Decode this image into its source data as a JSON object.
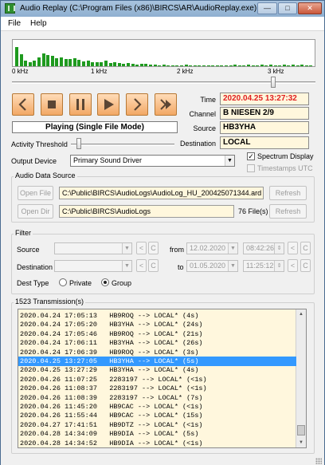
{
  "titlebar": {
    "title": "Audio Replay (C:\\Program Files (x86)\\BIRCS\\AR\\AudioReplay.exe)",
    "minimize": "—",
    "maximize": "□",
    "close": "✕"
  },
  "menu": {
    "file": "File",
    "help": "Help"
  },
  "spectrum": {
    "label_0": "0 kHz",
    "label_1": "1 kHz",
    "label_2": "2 kHz",
    "label_3": "3 kHz",
    "levels": [
      0.72,
      0.45,
      0.22,
      0.16,
      0.2,
      0.32,
      0.48,
      0.42,
      0.38,
      0.3,
      0.34,
      0.28,
      0.26,
      0.3,
      0.24,
      0.18,
      0.22,
      0.16,
      0.14,
      0.14,
      0.2,
      0.12,
      0.16,
      0.12,
      0.1,
      0.12,
      0.08,
      0.06,
      0.08,
      0.1,
      0.06,
      0.05,
      0.04,
      0.05,
      0.04,
      0.04,
      0.03,
      0.04,
      0.05,
      0.03,
      0.04,
      0.03,
      0.03,
      0.04,
      0.03,
      0.03,
      0.04,
      0.03,
      0.04,
      0.05,
      0.03,
      0.04,
      0.05,
      0.04,
      0.04,
      0.05,
      0.03,
      0.05,
      0.04,
      0.04,
      0.05,
      0.04,
      0.05,
      0.04,
      0.05,
      0.04,
      0.04
    ],
    "bar_color": "#1f9a1f",
    "filter_position": 0.86
  },
  "transport": {
    "prev_icon": "chevron-left-icon",
    "stop_icon": "stop-icon",
    "pause_icon": "pause-icon",
    "play_icon": "play-icon",
    "next_icon": "chevron-right-icon",
    "skip_icon": "skip-to-end-icon",
    "accent": "#f2a865"
  },
  "status": {
    "text": "Playing (Single File Mode)"
  },
  "info": {
    "time_label": "Time",
    "time_value": "2020.04.25 13:27:32",
    "time_color": "#e02020",
    "channel_label": "Channel",
    "channel_value": "B NIESEN 2/9",
    "source_label": "Source",
    "source_value": "HB3YHA",
    "destination_label": "Destination",
    "destination_value": "LOCAL"
  },
  "activity": {
    "label": "Activity Threshold",
    "level": 0.05
  },
  "output": {
    "label": "Output Device",
    "value": "Primary Sound Driver"
  },
  "options": {
    "spectrum_display": "Spectrum Display",
    "spectrum_checked": true,
    "timestamps_utc": "Timestamps UTC",
    "timestamps_checked": false
  },
  "audio_source": {
    "title": "Audio Data Source",
    "open_file": "Open File",
    "file_path": "C:\\Public\\BIRCS\\AudioLogs\\AudioLog_HU_200425071344.ard",
    "refresh1": "Refresh",
    "open_dir": "Open Dir",
    "dir_path": "C:\\Public\\BIRCS\\AudioLogs",
    "file_count": "76 File(s)",
    "refresh2": "Refresh"
  },
  "filter": {
    "title": "Filter",
    "source_label": "Source",
    "destination_label": "Destination",
    "lt": "<",
    "c": "C",
    "from_label": "from",
    "from_date": "12.02.2020",
    "from_time": "08:42:26",
    "to_label": "to",
    "to_date": "01.05.2020",
    "to_time": "11:25:12",
    "dest_type_label": "Dest Type",
    "private": "Private",
    "group": "Group",
    "group_selected": true
  },
  "transmissions": {
    "title": "1523 Transmission(s)",
    "selected_index": 5,
    "rows": [
      "2020.04.24 17:05:13   HB9ROQ --> LOCAL* (4s)",
      "2020.04.24 17:05:20   HB3YHA --> LOCAL* (24s)",
      "2020.04.24 17:05:46   HB9ROQ --> LOCAL* (21s)",
      "2020.04.24 17:06:11   HB3YHA --> LOCAL* (26s)",
      "2020.04.24 17:06:39   HB9ROQ --> LOCAL* (3s)",
      "2020.04.25 13:27:05   HB3YHA --> LOCAL* (5s)",
      "2020.04.25 13:27:29   HB3YHA --> LOCAL* (4s)",
      "2020.04.26 11:07:25   2283197 --> LOCAL* (<1s)",
      "2020.04.26 11:08:37   2283197 --> LOCAL* (<1s)",
      "2020.04.26 11:08:39   2283197 --> LOCAL* (7s)",
      "2020.04.26 11:45:20   HB9CAC --> LOCAL* (<1s)",
      "2020.04.26 11:55:44   HB9CAC --> LOCAL* (15s)",
      "2020.04.27 17:41:51   HB9DTZ --> LOCAL* (<1s)",
      "2020.04.28 14:34:09   HB9DIA --> LOCAL* (5s)",
      "2020.04.28 14:34:52   HB9DIA --> LOCAL* (<1s)"
    ]
  }
}
